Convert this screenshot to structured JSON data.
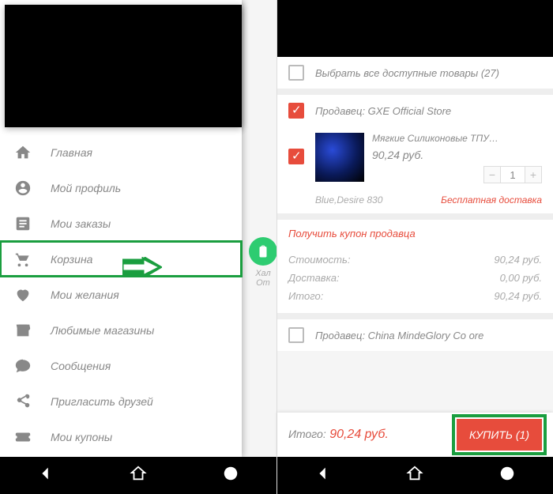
{
  "left": {
    "menu": [
      {
        "label": "Главная"
      },
      {
        "label": "Мой профиль"
      },
      {
        "label": "Мои заказы"
      },
      {
        "label": "Корзина"
      },
      {
        "label": "Мои желания"
      },
      {
        "label": "Любимые магазины"
      },
      {
        "label": "Сообщения"
      },
      {
        "label": "Пригласить друзей"
      },
      {
        "label": "Мои купоны"
      }
    ],
    "bg_hint": "Хал\nОт"
  },
  "right": {
    "select_all": "Выбрать все доступные товары (27)",
    "seller1_label": "Продавец: GXE Official Store",
    "product": {
      "title": "Мягкие Силиконовые ТПУ…",
      "price": "90,24 руб.",
      "qty": "1",
      "variant": "Blue,Desire 830",
      "shipping": "Бесплатная доставка"
    },
    "coupon": "Получить купон продавца",
    "summary": {
      "cost_label": "Стоимость:",
      "cost": "90,24 руб.",
      "ship_label": "Доставка:",
      "ship": "0,00 руб.",
      "total_label": "Итого:",
      "total": "90,24 руб."
    },
    "seller2_label": "Продавец: China MindeGlory Co         ore",
    "total_bar": {
      "label": "Итого:",
      "amount": "90,24 руб.",
      "buy": "КУПИТЬ (1)"
    }
  }
}
